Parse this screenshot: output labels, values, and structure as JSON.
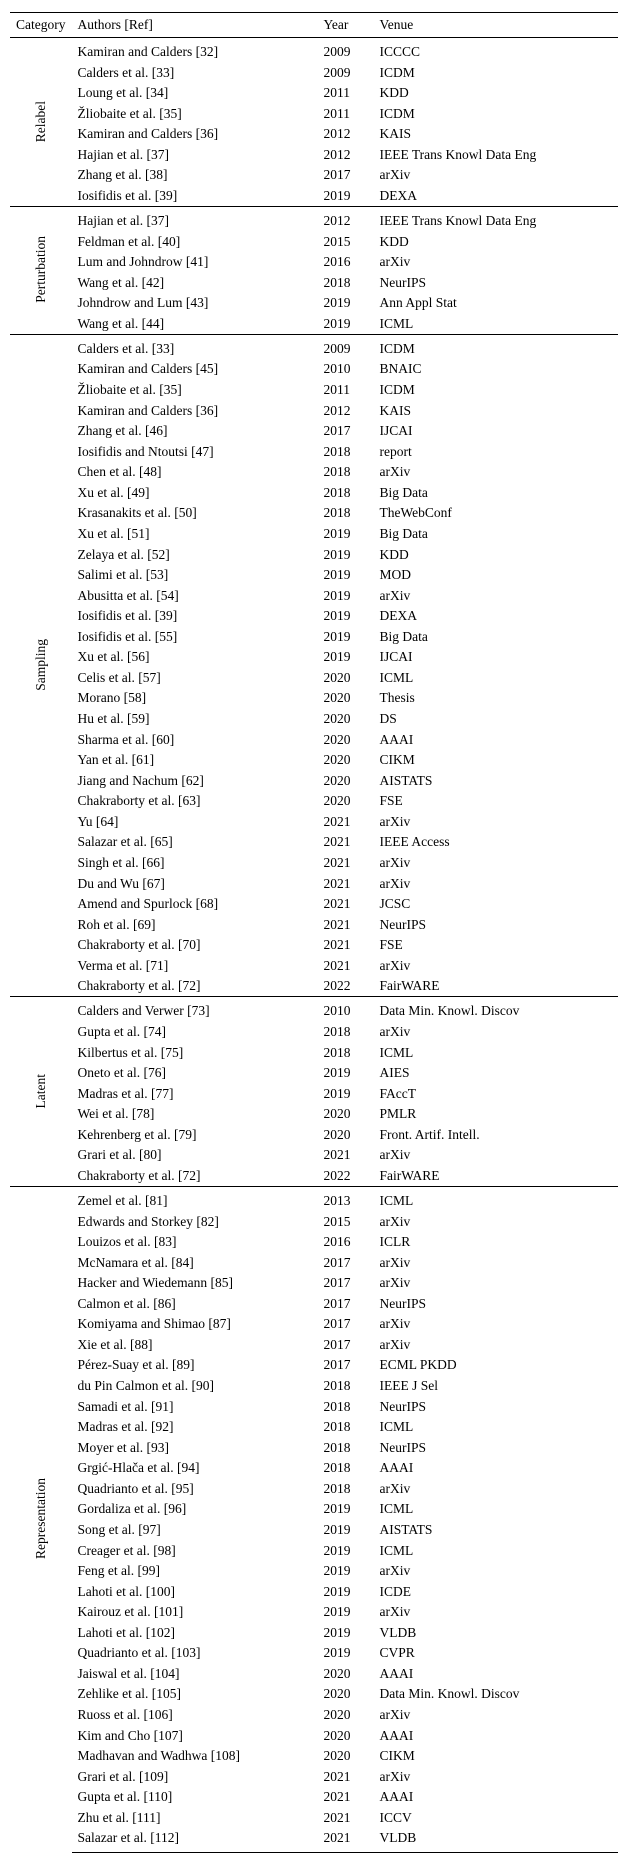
{
  "headers": {
    "category": "Category",
    "authors": "Authors [Ref]",
    "year": "Year",
    "venue": "Venue"
  },
  "groups": [
    {
      "label": "Relabel",
      "rows": [
        {
          "authors": "Kamiran and Calders [32]",
          "year": "2009",
          "venue": "ICCCC"
        },
        {
          "authors": "Calders et al. [33]",
          "year": "2009",
          "venue": "ICDM"
        },
        {
          "authors": "Loung et al. [34]",
          "year": "2011",
          "venue": "KDD"
        },
        {
          "authors": "Žliobaite et al. [35]",
          "year": "2011",
          "venue": "ICDM"
        },
        {
          "authors": "Kamiran and Calders [36]",
          "year": "2012",
          "venue": "KAIS"
        },
        {
          "authors": "Hajian et al. [37]",
          "year": "2012",
          "venue": "IEEE Trans Knowl Data Eng"
        },
        {
          "authors": "Zhang et al. [38]",
          "year": "2017",
          "venue": "arXiv"
        },
        {
          "authors": "Iosifidis et al. [39]",
          "year": "2019",
          "venue": "DEXA"
        }
      ]
    },
    {
      "label": "Perturbation",
      "rows": [
        {
          "authors": "Hajian et al. [37]",
          "year": "2012",
          "venue": "IEEE Trans Knowl Data Eng"
        },
        {
          "authors": "Feldman et al. [40]",
          "year": "2015",
          "venue": "KDD"
        },
        {
          "authors": "Lum and Johndrow [41]",
          "year": "2016",
          "venue": "arXiv"
        },
        {
          "authors": "Wang et al. [42]",
          "year": "2018",
          "venue": "NeurIPS"
        },
        {
          "authors": "Johndrow and Lum [43]",
          "year": "2019",
          "venue": "Ann Appl Stat"
        },
        {
          "authors": "Wang et al. [44]",
          "year": "2019",
          "venue": "ICML"
        }
      ]
    },
    {
      "label": "Sampling",
      "rows": [
        {
          "authors": "Calders et al. [33]",
          "year": "2009",
          "venue": "ICDM"
        },
        {
          "authors": "Kamiran and Calders [45]",
          "year": "2010",
          "venue": "BNAIC"
        },
        {
          "authors": "Žliobaite et al. [35]",
          "year": "2011",
          "venue": "ICDM"
        },
        {
          "authors": "Kamiran and Calders [36]",
          "year": "2012",
          "venue": "KAIS"
        },
        {
          "authors": "Zhang et al. [46]",
          "year": "2017",
          "venue": "IJCAI"
        },
        {
          "authors": "Iosifidis and Ntoutsi [47]",
          "year": "2018",
          "venue": "report"
        },
        {
          "authors": "Chen et al. [48]",
          "year": "2018",
          "venue": "arXiv"
        },
        {
          "authors": "Xu et al. [49]",
          "year": "2018",
          "venue": "Big Data"
        },
        {
          "authors": "Krasanakits et al. [50]",
          "year": "2018",
          "venue": "TheWebConf"
        },
        {
          "authors": "Xu et al. [51]",
          "year": "2019",
          "venue": "Big Data"
        },
        {
          "authors": "Zelaya et al. [52]",
          "year": "2019",
          "venue": "KDD"
        },
        {
          "authors": "Salimi et al. [53]",
          "year": "2019",
          "venue": "MOD"
        },
        {
          "authors": "Abusitta et al. [54]",
          "year": "2019",
          "venue": "arXiv"
        },
        {
          "authors": "Iosifidis et al. [39]",
          "year": "2019",
          "venue": "DEXA"
        },
        {
          "authors": "Iosifidis et al. [55]",
          "year": "2019",
          "venue": "Big Data"
        },
        {
          "authors": "Xu et al. [56]",
          "year": "2019",
          "venue": "IJCAI"
        },
        {
          "authors": "Celis et al. [57]",
          "year": "2020",
          "venue": "ICML"
        },
        {
          "authors": "Morano [58]",
          "year": "2020",
          "venue": "Thesis"
        },
        {
          "authors": "Hu et al. [59]",
          "year": "2020",
          "venue": "DS"
        },
        {
          "authors": "Sharma et al. [60]",
          "year": "2020",
          "venue": "AAAI"
        },
        {
          "authors": "Yan et al. [61]",
          "year": "2020",
          "venue": "CIKM"
        },
        {
          "authors": "Jiang and Nachum [62]",
          "year": "2020",
          "venue": "AISTATS"
        },
        {
          "authors": "Chakraborty et al. [63]",
          "year": "2020",
          "venue": "FSE"
        },
        {
          "authors": "Yu [64]",
          "year": "2021",
          "venue": "arXiv"
        },
        {
          "authors": "Salazar et al. [65]",
          "year": "2021",
          "venue": "IEEE Access"
        },
        {
          "authors": "Singh et al. [66]",
          "year": "2021",
          "venue": "arXiv"
        },
        {
          "authors": "Du and Wu [67]",
          "year": "2021",
          "venue": "arXiv"
        },
        {
          "authors": "Amend and Spurlock [68]",
          "year": "2021",
          "venue": "JCSC"
        },
        {
          "authors": "Roh et al. [69]",
          "year": "2021",
          "venue": "NeurIPS"
        },
        {
          "authors": "Chakraborty et al. [70]",
          "year": "2021",
          "venue": "FSE"
        },
        {
          "authors": "Verma et al. [71]",
          "year": "2021",
          "venue": "arXiv"
        },
        {
          "authors": "Chakraborty et al. [72]",
          "year": "2022",
          "venue": "FairWARE"
        }
      ]
    },
    {
      "label": "Latent",
      "rows": [
        {
          "authors": "Calders and Verwer [73]",
          "year": "2010",
          "venue": "Data Min. Knowl. Discov"
        },
        {
          "authors": "Gupta et al. [74]",
          "year": "2018",
          "venue": "arXiv"
        },
        {
          "authors": "Kilbertus et al. [75]",
          "year": "2018",
          "venue": "ICML"
        },
        {
          "authors": "Oneto et al. [76]",
          "year": "2019",
          "venue": "AIES"
        },
        {
          "authors": "Madras et al. [77]",
          "year": "2019",
          "venue": "FAccT"
        },
        {
          "authors": "Wei et al. [78]",
          "year": "2020",
          "venue": "PMLR"
        },
        {
          "authors": "Kehrenberg et al. [79]",
          "year": "2020",
          "venue": "Front. Artif. Intell."
        },
        {
          "authors": "Grari et al. [80]",
          "year": "2021",
          "venue": "arXiv"
        },
        {
          "authors": "Chakraborty et al. [72]",
          "year": "2022",
          "venue": "FairWARE"
        }
      ]
    },
    {
      "label": "Representation",
      "rows": [
        {
          "authors": "Zemel et al. [81]",
          "year": "2013",
          "venue": "ICML"
        },
        {
          "authors": "Edwards and Storkey [82]",
          "year": "2015",
          "venue": "arXiv"
        },
        {
          "authors": "Louizos et al. [83]",
          "year": "2016",
          "venue": "ICLR"
        },
        {
          "authors": "McNamara et al. [84]",
          "year": "2017",
          "venue": "arXiv"
        },
        {
          "authors": "Hacker and Wiedemann [85]",
          "year": "2017",
          "venue": "arXiv"
        },
        {
          "authors": "Calmon et al. [86]",
          "year": "2017",
          "venue": "NeurIPS"
        },
        {
          "authors": "Komiyama and Shimao [87]",
          "year": "2017",
          "venue": "arXiv"
        },
        {
          "authors": "Xie et al. [88]",
          "year": "2017",
          "venue": "arXiv"
        },
        {
          "authors": "Pérez-Suay et al. [89]",
          "year": "2017",
          "venue": "ECML PKDD"
        },
        {
          "authors": "du Pin Calmon et al. [90]",
          "year": "2018",
          "venue": "IEEE J Sel"
        },
        {
          "authors": "Samadi et al. [91]",
          "year": "2018",
          "venue": "NeurIPS"
        },
        {
          "authors": "Madras et al. [92]",
          "year": "2018",
          "venue": "ICML"
        },
        {
          "authors": "Moyer et al. [93]",
          "year": "2018",
          "venue": "NeurIPS"
        },
        {
          "authors": "Grgić-Hlača et al. [94]",
          "year": "2018",
          "venue": "AAAI"
        },
        {
          "authors": "Quadrianto et al. [95]",
          "year": "2018",
          "venue": "arXiv"
        },
        {
          "authors": "Gordaliza et al. [96]",
          "year": "2019",
          "venue": "ICML"
        },
        {
          "authors": "Song et al. [97]",
          "year": "2019",
          "venue": "AISTATS"
        },
        {
          "authors": "Creager et al. [98]",
          "year": "2019",
          "venue": "ICML"
        },
        {
          "authors": "Feng et al. [99]",
          "year": "2019",
          "venue": "arXiv"
        },
        {
          "authors": "Lahoti et al. [100]",
          "year": "2019",
          "venue": "ICDE"
        },
        {
          "authors": "Kairouz et al. [101]",
          "year": "2019",
          "venue": "arXiv"
        },
        {
          "authors": "Lahoti et al. [102]",
          "year": "2019",
          "venue": "VLDB"
        },
        {
          "authors": "Quadrianto et al. [103]",
          "year": "2019",
          "venue": "CVPR"
        },
        {
          "authors": "Jaiswal et al. [104]",
          "year": "2020",
          "venue": "AAAI"
        },
        {
          "authors": "Zehlike et al. [105]",
          "year": "2020",
          "venue": "Data Min. Knowl. Discov"
        },
        {
          "authors": "Ruoss et al. [106]",
          "year": "2020",
          "venue": "arXiv"
        },
        {
          "authors": "Kim and Cho [107]",
          "year": "2020",
          "venue": "AAAI"
        },
        {
          "authors": "Madhavan and Wadhwa [108]",
          "year": "2020",
          "venue": "CIKM"
        },
        {
          "authors": "Grari et al. [109]",
          "year": "2021",
          "venue": "arXiv"
        },
        {
          "authors": "Gupta et al. [110]",
          "year": "2021",
          "venue": "AAAI"
        },
        {
          "authors": "Zhu et al. [111]",
          "year": "2021",
          "venue": "ICCV"
        },
        {
          "authors": "Salazar et al. [112]",
          "year": "2021",
          "venue": "VLDB"
        }
      ]
    }
  ]
}
